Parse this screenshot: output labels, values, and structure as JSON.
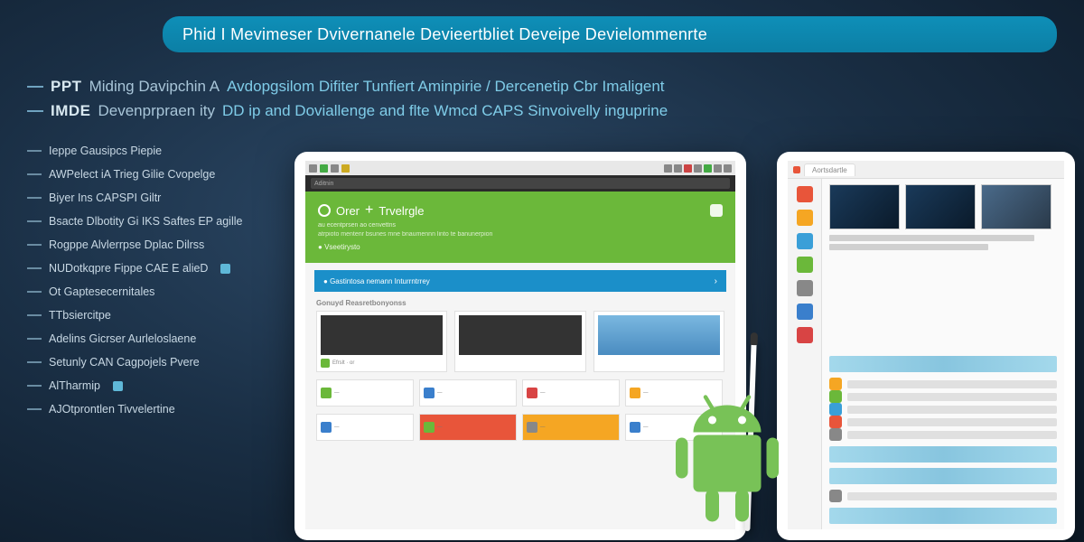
{
  "banner": {
    "title": "Phid I Mevimeser Dvivernanele Devieertbliet Deveipe Devielommenrte"
  },
  "subtitle": {
    "line1_a": "PPT",
    "line1_b": "Miding Davipchin A",
    "line1_c": "Avdopgsilom Difiter Tunfiert Aminpirie / Dercenetip Cbr Imaligent",
    "line2_a": "IMDE",
    "line2_b": "Devenprpraen ity",
    "line2_c": "DD ip and Doviallenge and flte Wmcd CAPS Sinvoivelly inguprine"
  },
  "bullets": [
    {
      "text": "Ieppe Gausipcs Piepie",
      "dot": false
    },
    {
      "text": "AWPelect iA Trieg Gilie Cvopelge",
      "dot": false
    },
    {
      "text": "Biyer Ins CAPSPI Giltr",
      "dot": false
    },
    {
      "text": "Bsacte Dlbotity Gi IKS Saftes EP agille",
      "dot": false
    },
    {
      "text": "Rogppe Alvlerrpse Dplac Dilrss",
      "dot": false
    },
    {
      "text": "NUDotkqpre Fippe CAE E alieD",
      "dot": true
    },
    {
      "text": "Ot Gaptesecernitales",
      "dot": false
    },
    {
      "text": "TTbsiercitpe",
      "dot": false
    },
    {
      "text": "Adelins Gicrser Aurleloslaene",
      "dot": false
    },
    {
      "text": "Setunly CAN Cagpojels Pvere",
      "dot": false
    },
    {
      "text": "AlTharmip",
      "dot": true
    },
    {
      "text": "AJOtprontlen Tivvelertine",
      "dot": false
    }
  ],
  "tablet1": {
    "addr": "Aditnin",
    "hero_title_a": "Orer",
    "hero_title_b": "Trvelrgle",
    "hero_sub1": "au ecentprsen ao cenvettns",
    "hero_sub2": "atrpioto mentenr bsunes mne bnaumennn linto te banunerpion",
    "hero_badge": "Vseetirysto",
    "bluebar_text": "Gastintosa nemann Inturrntrrey",
    "section": "Gonuyd Reasretbonyonss",
    "tile_colors": [
      "#6bb83a",
      "#3a7fcc",
      "#d84444",
      "#f5a623",
      "#3a7fcc",
      "#6bb83a",
      "#888888",
      "#3a7fcc"
    ]
  },
  "tablet2": {
    "tab": "Aortsdartle",
    "side_colors": [
      "#e8553a",
      "#f5a623",
      "#3a9fd8",
      "#6bb83a",
      "#888888",
      "#3a7fcc",
      "#d84444"
    ],
    "item_colors": [
      "#f5a623",
      "#6bb83a",
      "#3a9fd8",
      "#e8553a",
      "#888888"
    ]
  }
}
